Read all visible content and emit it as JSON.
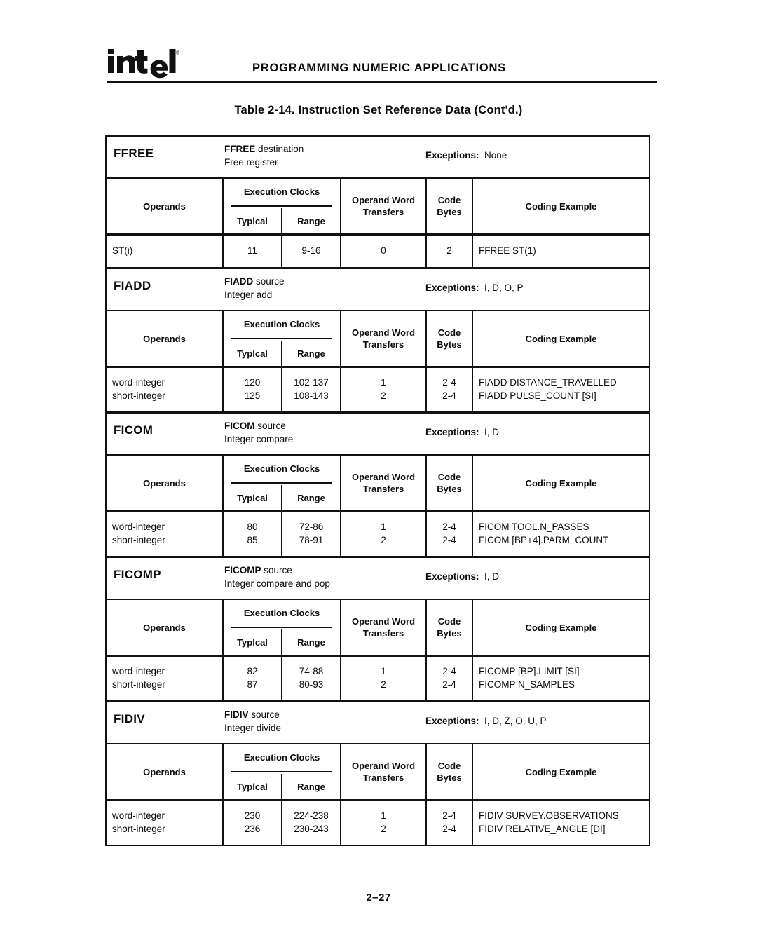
{
  "header": {
    "logo_text": "intel",
    "logo_mark": "®",
    "running_head": "PROGRAMMING NUMERIC APPLICATIONS"
  },
  "table_title": "Table 2-14.  Instruction Set Reference Data (Cont'd.)",
  "column_headers": {
    "operands": "Operands",
    "execution_clocks": "Execution Clocks",
    "typical": "Typlcal",
    "range": "Range",
    "operand_word": "Operand Word",
    "transfers": "Transfers",
    "code": "Code",
    "bytes": "Bytes",
    "coding_example": "Coding Example"
  },
  "exceptions_label": "Exceptions:",
  "blocks": [
    {
      "mnemonic": "FFREE",
      "syntax_mnemonic": "FFREE",
      "syntax_operand": " destination",
      "description": "Free register",
      "exceptions": "None",
      "rows": [
        {
          "operands": "ST(i)",
          "typical": "11",
          "range": "9-16",
          "transfers": "0",
          "bytes": "2",
          "example": "FFREE  ST(1)"
        }
      ]
    },
    {
      "mnemonic": "FIADD",
      "syntax_mnemonic": "FIADD",
      "syntax_operand": " source",
      "description": "Integer add",
      "exceptions": "I, D, O, P",
      "rows": [
        {
          "operands": "word-integer",
          "typical": "120",
          "range": "102-137",
          "transfers": "1",
          "bytes": "2-4",
          "example": "FIADD  DISTANCE_TRAVELLED"
        },
        {
          "operands": "short-integer",
          "typical": "125",
          "range": "108-143",
          "transfers": "2",
          "bytes": "2-4",
          "example": "FIADD  PULSE_COUNT [SI]"
        }
      ]
    },
    {
      "mnemonic": "FICOM",
      "syntax_mnemonic": "FICOM",
      "syntax_operand": " source",
      "description": "Integer compare",
      "exceptions": "I, D",
      "rows": [
        {
          "operands": "word-integer",
          "typical": "80",
          "range": "72-86",
          "transfers": "1",
          "bytes": "2-4",
          "example": "FICOM  TOOL.N_PASSES"
        },
        {
          "operands": "short-integer",
          "typical": "85",
          "range": "78-91",
          "transfers": "2",
          "bytes": "2-4",
          "example": "FICOM  [BP+4].PARM_COUNT"
        }
      ]
    },
    {
      "mnemonic": "FICOMP",
      "syntax_mnemonic": "FICOMP",
      "syntax_operand": " source",
      "description": "Integer compare and pop",
      "exceptions": "I, D",
      "rows": [
        {
          "operands": "word-integer",
          "typical": "82",
          "range": "74-88",
          "transfers": "1",
          "bytes": "2-4",
          "example": "FICOMP  [BP].LIMIT [SI]"
        },
        {
          "operands": "short-integer",
          "typical": "87",
          "range": "80-93",
          "transfers": "2",
          "bytes": "2-4",
          "example": "FICOMP  N_SAMPLES"
        }
      ]
    },
    {
      "mnemonic": "FIDIV",
      "syntax_mnemonic": "FIDIV",
      "syntax_operand": " source",
      "description": "Integer divide",
      "exceptions": "I, D, Z, O, U, P",
      "rows": [
        {
          "operands": "word-integer",
          "typical": "230",
          "range": "224-238",
          "transfers": "1",
          "bytes": "2-4",
          "example": "FIDIV  SURVEY.OBSERVATIONS"
        },
        {
          "operands": "short-integer",
          "typical": "236",
          "range": "230-243",
          "transfers": "2",
          "bytes": "2-4",
          "example": "FIDIV  RELATIVE_ANGLE [DI]"
        }
      ]
    }
  ],
  "page_number": "2–27"
}
